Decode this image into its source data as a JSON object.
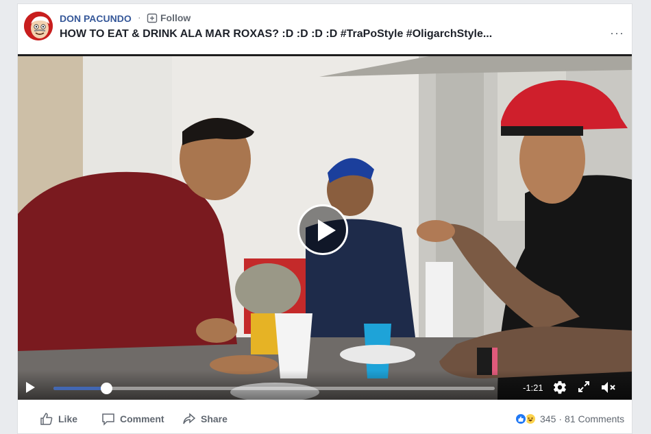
{
  "post": {
    "author": "DON PACUNDO",
    "separator": "·",
    "follow_label": "Follow",
    "title": "HOW TO EAT & DRINK ALA MAR ROXAS? :D :D :D :D #TraPoStyle #OligarchStyle...",
    "more_label": "···"
  },
  "video": {
    "progress": 0.12,
    "time_remaining": "-1:21",
    "icons": {
      "play": "play-icon",
      "settings": "gear-icon",
      "fullscreen": "expand-icon",
      "mute": "volume-muted-icon"
    }
  },
  "footer": {
    "like_label": "Like",
    "comment_label": "Comment",
    "share_label": "Share",
    "reaction_count": "345",
    "separator": "·",
    "comments_count": "81 Comments"
  },
  "colors": {
    "brand_blue": "#4267b2",
    "link_blue": "#365899",
    "text_gray": "#606770"
  }
}
